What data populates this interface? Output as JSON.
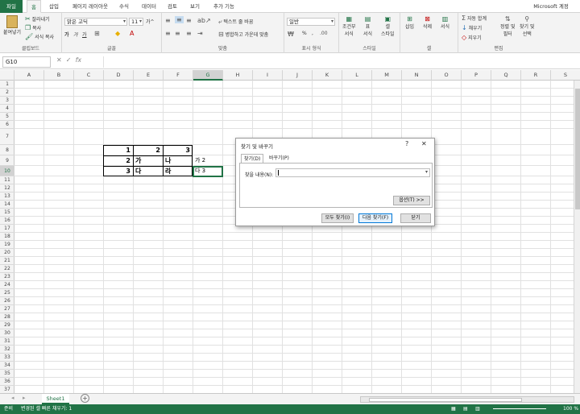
{
  "ribbon_tabs": [
    "파일",
    "홈",
    "삽입",
    "페이지 레이아웃",
    "수식",
    "데이터",
    "검토",
    "보기",
    "추가 기능"
  ],
  "account": "Microsoft 계정",
  "ribbon": {
    "clipboard": {
      "label": "클립보드",
      "paste": "붙여넣기",
      "cut": "잘라내기",
      "copy": "복사",
      "format_painter": "서식 복사"
    },
    "font": {
      "label": "글꼴",
      "font_name": "맑은 고딕",
      "font_size": "11",
      "bold": "가",
      "italic": "가",
      "underline": "가",
      "grow": "가^",
      "shrink": "가ˇ"
    },
    "alignment": {
      "label": "맞춤",
      "wrap": "텍스트 줄 바꿈",
      "merge": "병합하고 가운데 맞춤"
    },
    "number": {
      "label": "표시 형식",
      "format": "일반",
      "percent": "%",
      "comma": ","
    },
    "styles": {
      "label": "스타일",
      "conditional": "조건부\n서식",
      "table": "표\n서식",
      "cell_styles": "셀\n스타일"
    },
    "cells": {
      "label": "셀",
      "insert": "삽입",
      "delete": "삭제",
      "format": "서식"
    },
    "editing": {
      "label": "편집",
      "autosum": "자동 합계",
      "fill": "채우기",
      "clear": "지우기",
      "sort": "정렬 및\n필터",
      "find": "찾기 및\n선택"
    }
  },
  "formula_bar": {
    "name_box": "G10",
    "fx": "fx",
    "formula": ""
  },
  "columns": [
    "A",
    "B",
    "C",
    "D",
    "E",
    "F",
    "G",
    "H",
    "I",
    "J",
    "K",
    "L",
    "M",
    "N",
    "O",
    "P",
    "Q",
    "R",
    "S"
  ],
  "selected_column": "G",
  "selected_row": "10",
  "rows": [
    "1",
    "2",
    "3",
    "4",
    "5",
    "6",
    "7",
    "8",
    "9",
    "10",
    "11",
    "12",
    "13",
    "14",
    "15",
    "16",
    "17",
    "18",
    "19",
    "20",
    "21",
    "22",
    "23",
    "24",
    "25",
    "26",
    "27",
    "28",
    "29",
    "30",
    "31",
    "32",
    "33",
    "34",
    "35",
    "36",
    "37",
    "38"
  ],
  "cells": {
    "D8": "1",
    "E8": "2",
    "F8": "3",
    "D9": "2",
    "E9": "가",
    "F9": "나",
    "G9": "가 2",
    "D10": "3",
    "E10": "다",
    "F10": "라",
    "G10": "다 3"
  },
  "dialog": {
    "title": "찾기 및 바꾸기",
    "help": "?",
    "close": "✕",
    "tabs": [
      "찾기(D)",
      "바꾸기(P)"
    ],
    "find_label": "찾을 내용(N):",
    "find_value": "",
    "options": "옵션(T) >>",
    "find_all": "모두 찾기(I)",
    "find_next": "다음 찾기(F)",
    "close_btn": "닫기"
  },
  "sheet": {
    "tab": "Sheet1",
    "add": "+"
  },
  "status": {
    "mode": "준비",
    "message": "변경된 셀 빠른 채우기: 1",
    "zoom": "100 %"
  }
}
